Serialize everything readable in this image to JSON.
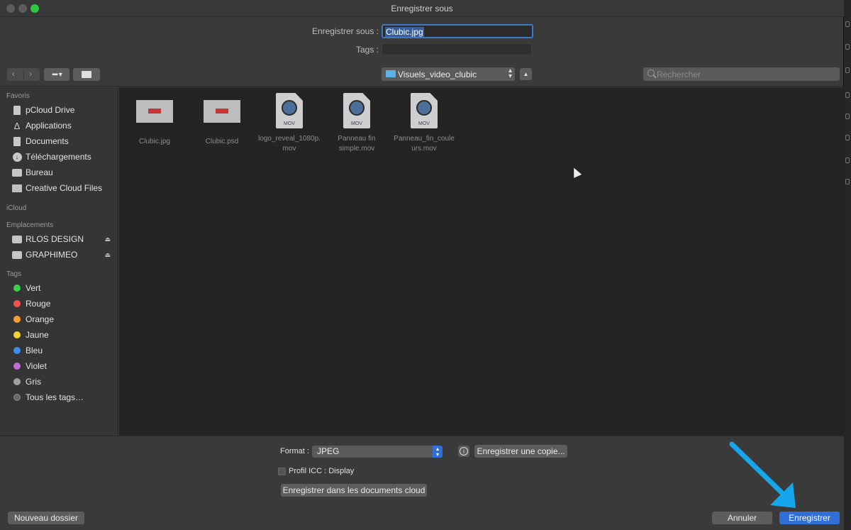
{
  "window": {
    "title": "Enregistrer sous"
  },
  "header": {
    "save_as_label": "Enregistrer sous :",
    "filename": "Clubic.jpg",
    "tags_label": "Tags :"
  },
  "toolbar": {
    "back_icon": "chevron-left-icon",
    "forward_icon": "chevron-right-icon",
    "view_icon": "grid-view-icon",
    "folder_icon": "new-folder-icon",
    "path": "Visuels_video_clubic",
    "up_icon": "chevron-up-icon",
    "search_placeholder": "Rechercher"
  },
  "sidebar": {
    "favorites_title": "Favoris",
    "favorites": [
      {
        "label": "pCloud Drive",
        "icon": "document-icon"
      },
      {
        "label": "Applications",
        "icon": "applications-icon"
      },
      {
        "label": "Documents",
        "icon": "document-icon"
      },
      {
        "label": "Téléchargements",
        "icon": "download-icon"
      },
      {
        "label": "Bureau",
        "icon": "desktop-icon"
      },
      {
        "label": "Creative Cloud Files",
        "icon": "folder-icon"
      }
    ],
    "icloud_title": "iCloud",
    "locations_title": "Emplacements",
    "locations": [
      {
        "label": "RLOS DESIGN",
        "icon": "disk-icon"
      },
      {
        "label": "GRAPHIMEO",
        "icon": "disk-icon"
      }
    ],
    "tags_title": "Tags",
    "tags": [
      {
        "label": "Vert",
        "color": "#3ecf4f"
      },
      {
        "label": "Rouge",
        "color": "#f2534d"
      },
      {
        "label": "Orange",
        "color": "#f5a030"
      },
      {
        "label": "Jaune",
        "color": "#f2d230"
      },
      {
        "label": "Bleu",
        "color": "#3f8cf0"
      },
      {
        "label": "Violet",
        "color": "#c26bd8"
      },
      {
        "label": "Gris",
        "color": "#a0a0a0"
      },
      {
        "label": "Tous les tags…",
        "color": "#6a6a6a"
      }
    ]
  },
  "files": [
    {
      "name": "Clubic.jpg",
      "type": "image"
    },
    {
      "name": "Clubic.psd",
      "type": "image"
    },
    {
      "name": "logo_reveal_1080p.mov",
      "type": "mov",
      "badge": "MOV"
    },
    {
      "name": "Panneau fin simple.mov",
      "type": "mov",
      "badge": "MOV"
    },
    {
      "name": "Panneau_fin_couleurs.mov",
      "type": "mov",
      "badge": "MOV"
    }
  ],
  "options": {
    "format_label": "Format :",
    "format_value": "JPEG",
    "save_copy_label": "Enregistrer une copie...",
    "icc_label": "Profil ICC : Display",
    "cloud_label": "Enregistrer dans les documents cloud"
  },
  "footer": {
    "new_folder_label": "Nouveau dossier",
    "cancel_label": "Annuler",
    "save_label": "Enregistrer"
  },
  "colors": {
    "accent": "#2f6fd6",
    "annotation_arrow": "#16a6ec"
  }
}
